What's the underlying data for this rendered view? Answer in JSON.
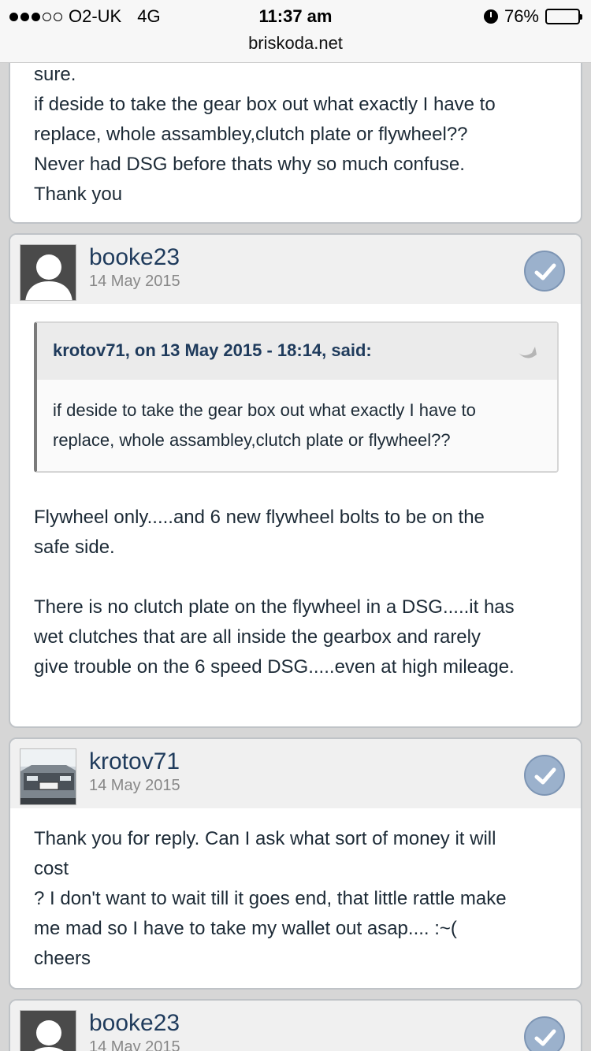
{
  "status_bar": {
    "carrier": "O2-UK",
    "network": "4G",
    "time": "11:37 am",
    "battery": "76%",
    "battery_level": 0.76,
    "domain": "briskoda.net"
  },
  "top_post": {
    "lines": [
      "sure.",
      "if deside to take the gear box out what exactly I have to",
      "replace, whole assambley,clutch plate or flywheel??",
      "Never had DSG before thats why so much confuse.",
      "Thank you"
    ]
  },
  "posts": [
    {
      "username": "booke23",
      "date": "14 May 2015",
      "quote": {
        "header": "krotov71, on 13 May 2015 - 18:14, said:",
        "lines": [
          "if deside to take the gear box out what exactly I have to",
          "replace, whole assambley,clutch plate or flywheel??"
        ]
      },
      "paragraphs": [
        [
          "Flywheel only.....and 6 new flywheel bolts to be on the",
          "safe side."
        ],
        [
          "There is no clutch plate on the flywheel in a DSG.....it has",
          "wet clutches that are all inside the gearbox and rarely",
          "give trouble on the 6 speed DSG.....even at high mileage."
        ]
      ]
    },
    {
      "username": "krotov71",
      "date": "14 May 2015",
      "lines": [
        "Thank you for reply. Can I ask what sort of money it will",
        "cost",
        "? I don't want to wait till it goes end, that little rattle make",
        "me mad so I have to take my wallet out asap.... :~(",
        "cheers"
      ]
    },
    {
      "username": "booke23",
      "date": "14 May 2015"
    }
  ]
}
